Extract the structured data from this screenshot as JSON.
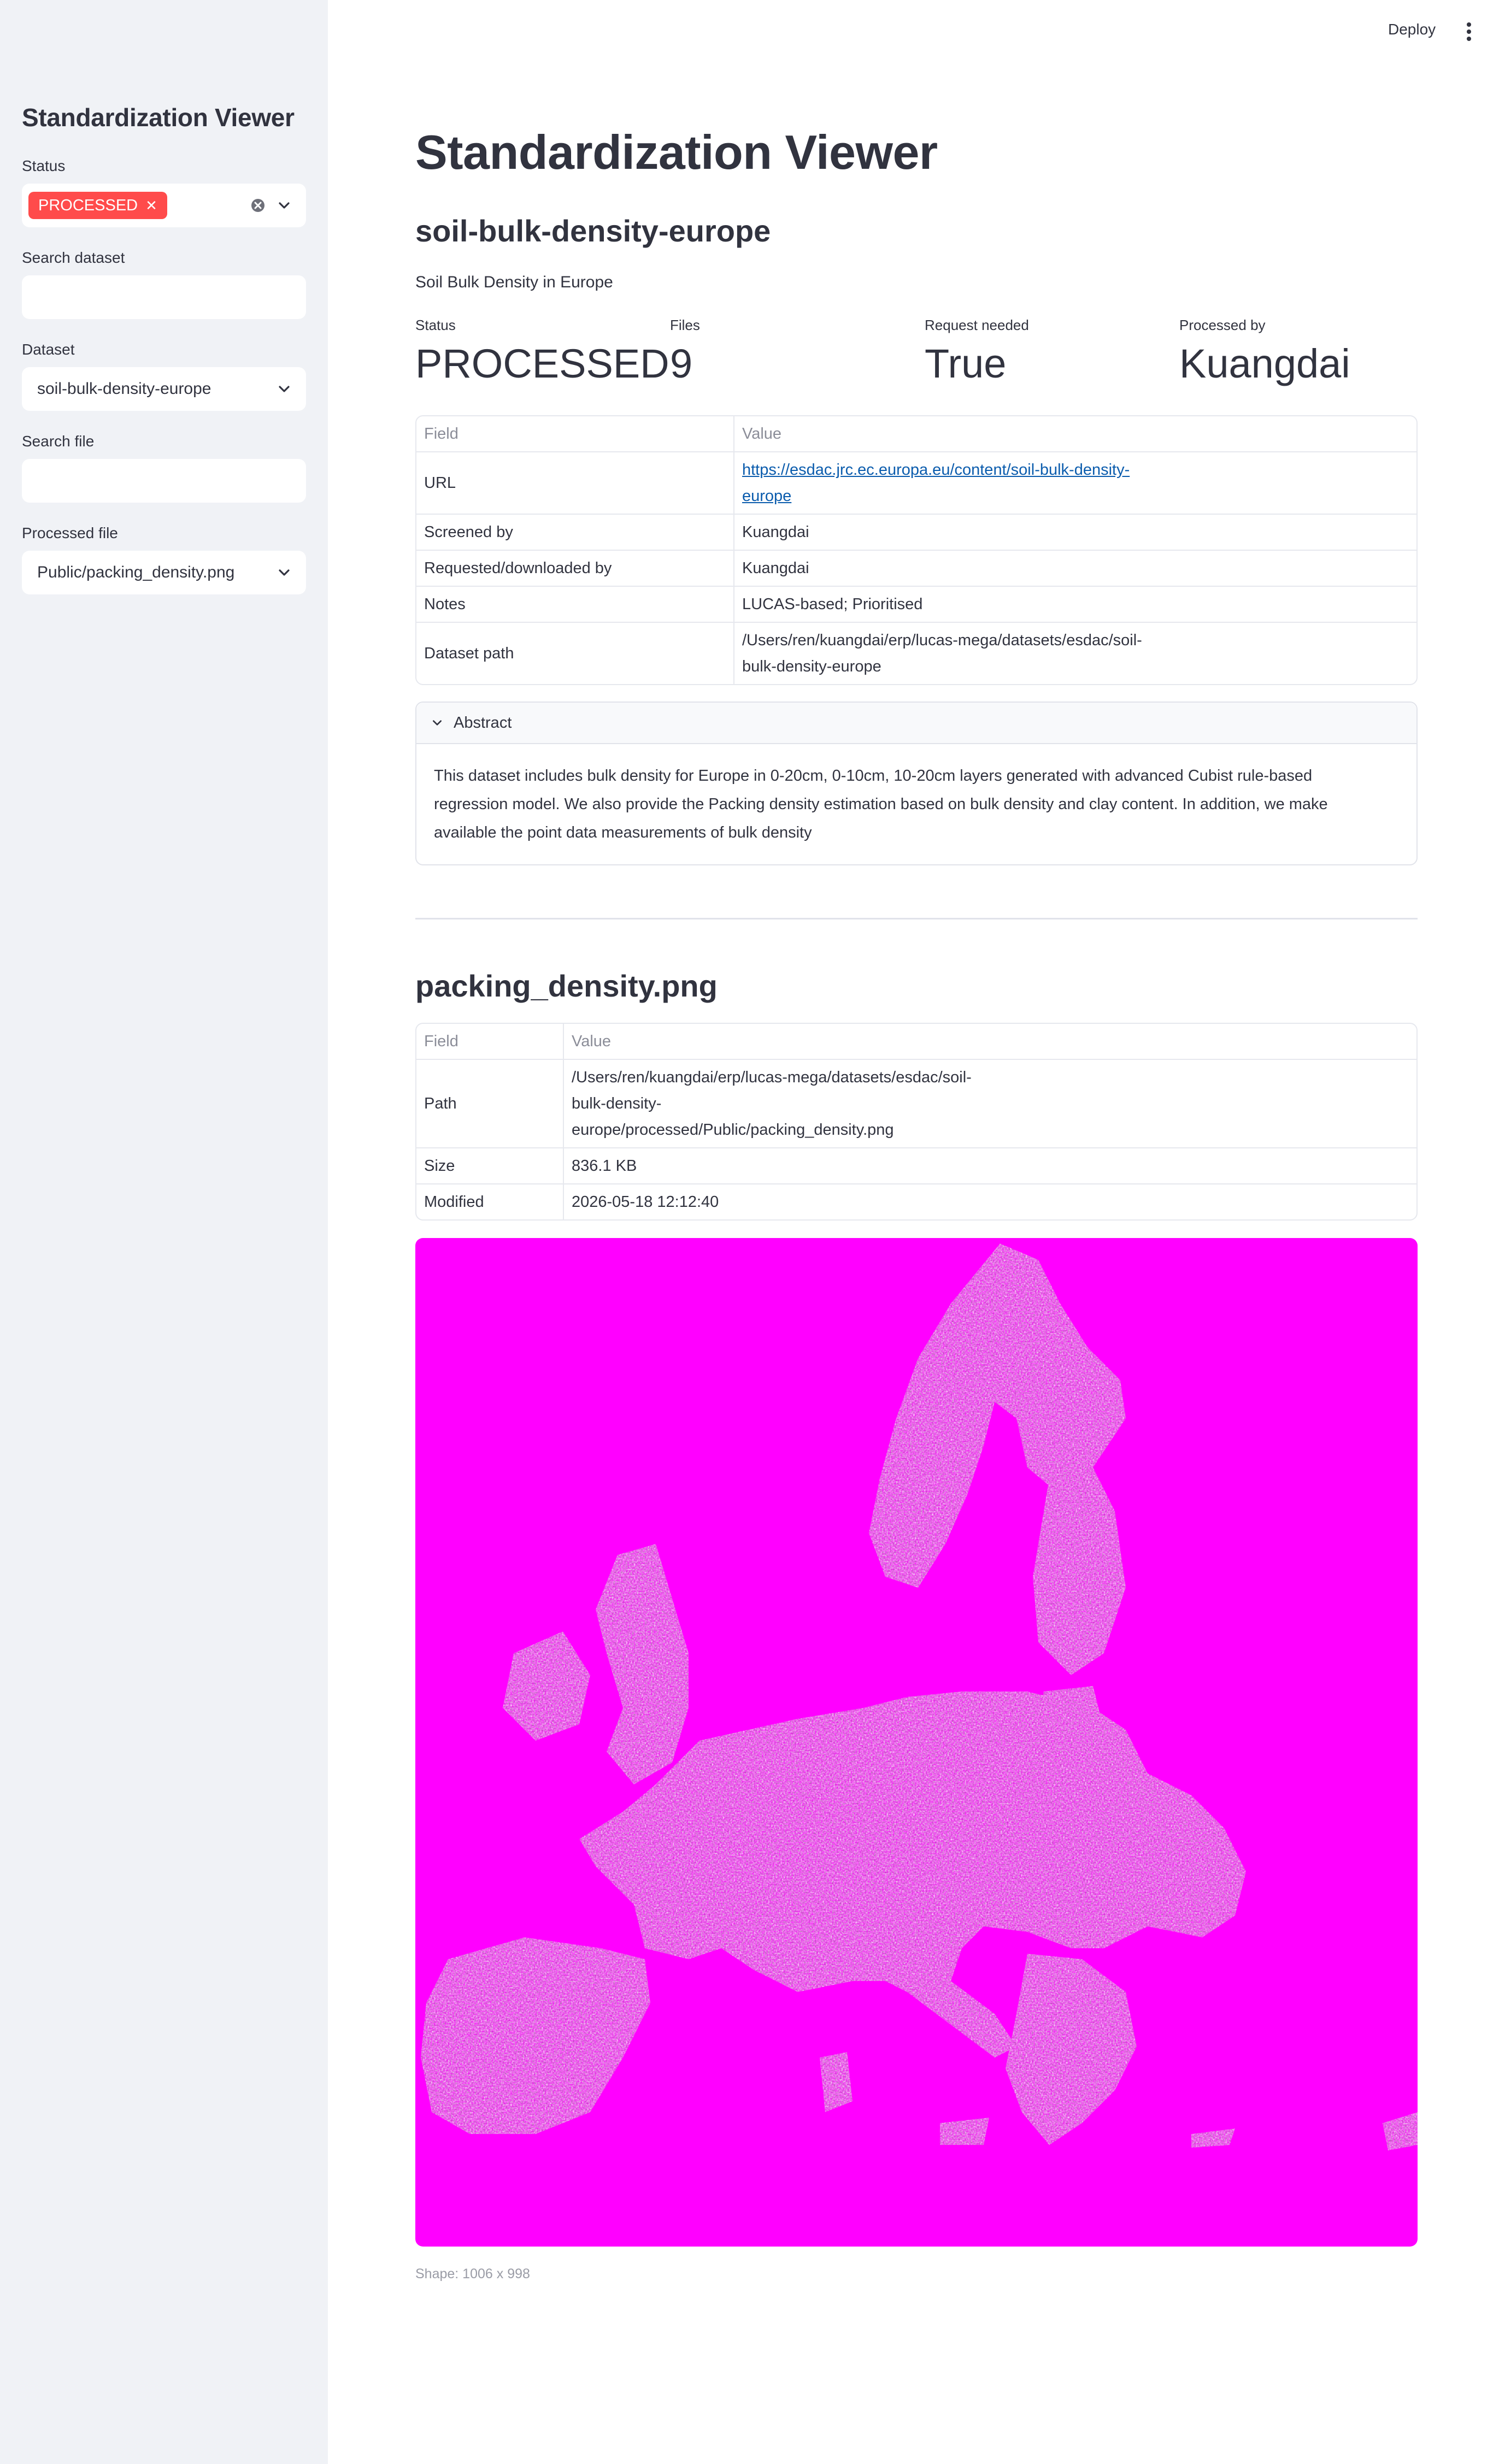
{
  "sidebar": {
    "title": "Standardization Viewer",
    "status": {
      "label": "Status",
      "selected_tag": "PROCESSED",
      "tag_color": "#ff4b4b"
    },
    "search_dataset": {
      "label": "Search dataset",
      "value": ""
    },
    "dataset": {
      "label": "Dataset",
      "value": "soil-bulk-density-europe"
    },
    "search_file": {
      "label": "Search file",
      "value": ""
    },
    "processed_file": {
      "label": "Processed file",
      "value": "Public/packing_density.png"
    }
  },
  "header": {
    "deploy_label": "Deploy",
    "menu_icon": "kebab-menu-icon"
  },
  "main": {
    "title": "Standardization Viewer",
    "dataset_heading": "soil-bulk-density-europe",
    "dataset_caption": "Soil Bulk Density in Europe",
    "metrics": [
      {
        "label": "Status",
        "value": "PROCESSED"
      },
      {
        "label": "Files",
        "value": "9"
      },
      {
        "label": "Request needed",
        "value": "True"
      },
      {
        "label": "Processed by",
        "value": "Kuangdai"
      }
    ],
    "dataset_table": {
      "columns": [
        "Field",
        "Value"
      ],
      "rows": [
        {
          "field": "URL",
          "value": "https://esdac.jrc.ec.europa.eu/content/soil-bulk-density-europe",
          "value_lines": [
            "https://esdac.jrc.ec.europa.eu/content/soil-bulk-density-",
            "europe"
          ]
        },
        {
          "field": "Screened by",
          "value": "Kuangdai"
        },
        {
          "field": "Requested/downloaded by",
          "value": "Kuangdai"
        },
        {
          "field": "Notes",
          "value": "LUCAS-based; Prioritised"
        },
        {
          "field": "Dataset path",
          "value": "/Users/ren/kuangdai/erp/lucas-mega/datasets/esdac/soil-bulk-density-europe",
          "value_lines": [
            "/Users/ren/kuangdai/erp/lucas-mega/datasets/esdac/soil-",
            "bulk-density-europe"
          ]
        }
      ]
    },
    "abstract": {
      "label": "Abstract",
      "text_lines": [
        "This dataset includes bulk density for Europe in 0-20cm, 0-10cm, 10-20cm layers generated with advanced Cubist rule-based",
        "regression model. We also provide the Packing density estimation based on bulk density and clay content. In addition, we make",
        "available the point data measurements of bulk density"
      ]
    },
    "file_heading": "packing_density.png",
    "file_table": {
      "columns": [
        "Field",
        "Value"
      ],
      "rows": [
        {
          "field": "Path",
          "value_lines": [
            "/Users/ren/kuangdai/erp/lucas-mega/datasets/esdac/soil-",
            "bulk-density-",
            "europe/processed/Public/packing_density.png"
          ]
        },
        {
          "field": "Size",
          "value": "836.1 KB"
        },
        {
          "field": "Modified",
          "value": "2026-05-18 12:12:40"
        }
      ]
    },
    "image": {
      "background_color": "#ff00ff",
      "caption": "Shape: 1006 x 998"
    }
  }
}
